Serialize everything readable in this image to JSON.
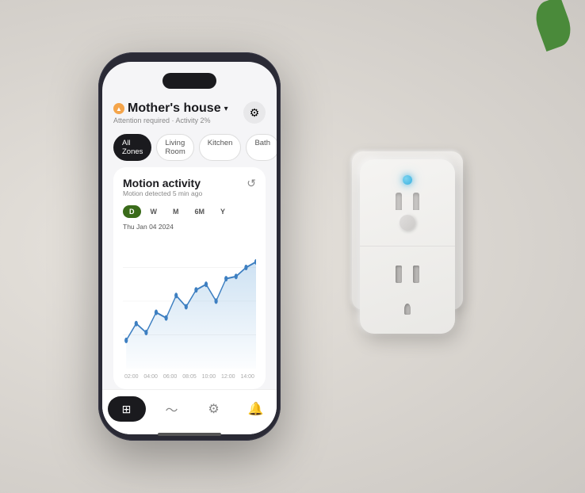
{
  "scene": {
    "background_color": "#d8d5d0"
  },
  "phone": {
    "header": {
      "title": "Mother's house",
      "subtitle": "Attention required · Activity 2%",
      "chevron": "▾",
      "alert_color": "#f4a44a"
    },
    "zones": {
      "tabs": [
        {
          "label": "All Zones",
          "active": true
        },
        {
          "label": "Living Room",
          "active": false
        },
        {
          "label": "Kitchen",
          "active": false
        },
        {
          "label": "Bath",
          "active": false
        }
      ]
    },
    "activity_card": {
      "title": "Motion activity",
      "subtitle": "Motion detected 5 min ago",
      "time_ranges": [
        {
          "label": "D",
          "active": true
        },
        {
          "label": "W",
          "active": false
        },
        {
          "label": "M",
          "active": false
        },
        {
          "label": "6M",
          "active": false
        },
        {
          "label": "Y",
          "active": false
        }
      ],
      "date": "Thu Jan 04 2024",
      "x_labels": [
        "02:00",
        "04:00",
        "06:00",
        "08:05",
        "10:00",
        "12:00",
        "14:00"
      ]
    },
    "nav": {
      "items": [
        {
          "icon": "⊞",
          "active": true,
          "label": "grid"
        },
        {
          "icon": "📈",
          "active": false,
          "label": "activity"
        },
        {
          "icon": "⚙",
          "active": false,
          "label": "settings"
        },
        {
          "icon": "🔔",
          "active": false,
          "label": "notifications"
        }
      ]
    }
  }
}
